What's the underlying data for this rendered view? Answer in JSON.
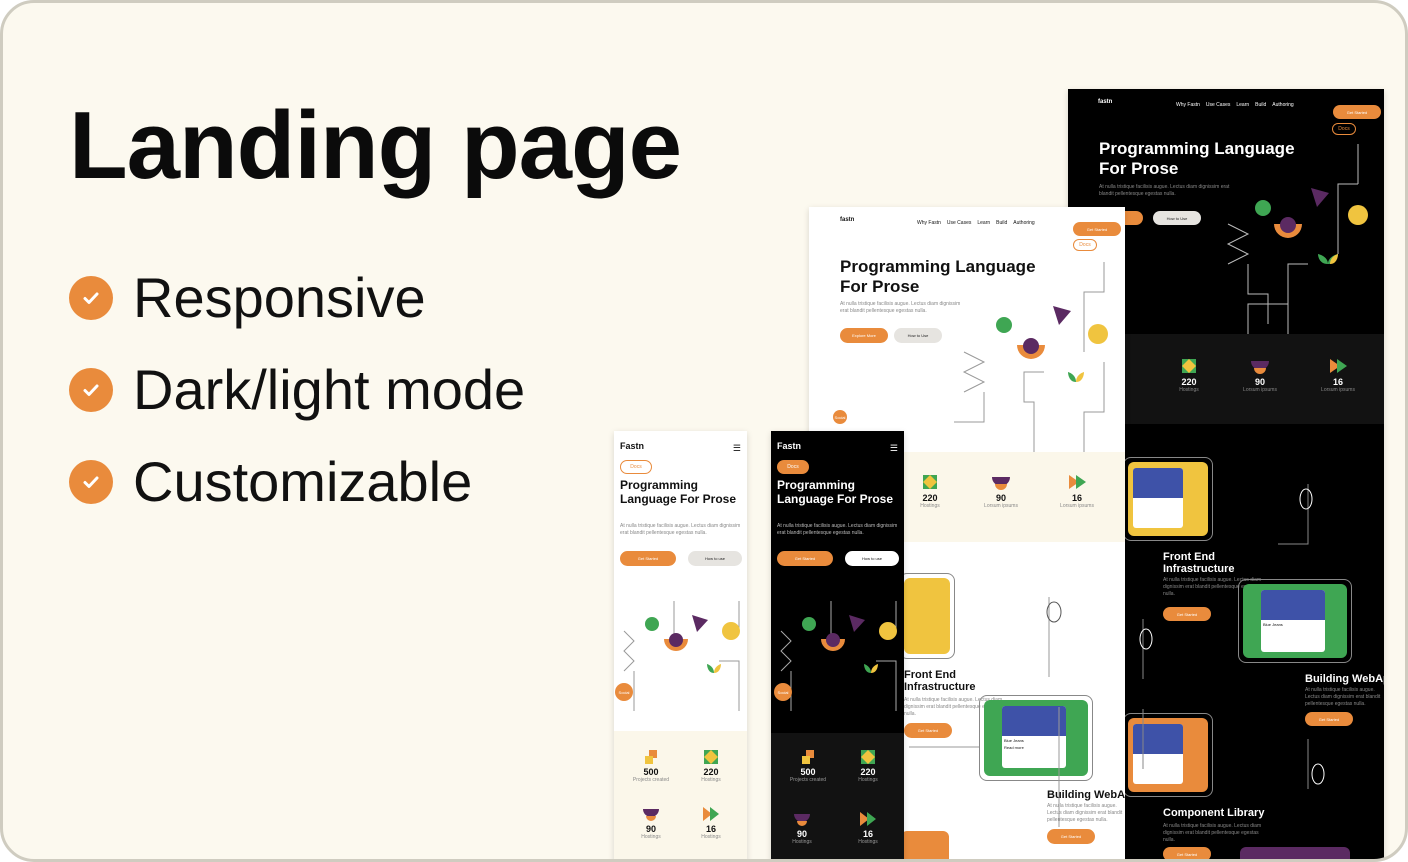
{
  "headline": "Landing page",
  "features": [
    {
      "label": "Responsive",
      "icon": "check-circle-icon"
    },
    {
      "label": "Dark/light mode",
      "icon": "check-circle-icon"
    },
    {
      "label": "Customizable",
      "icon": "check-circle-icon"
    }
  ],
  "colors": {
    "accent": "#e98b3c",
    "background": "#fcf9ef",
    "green": "#3fa653",
    "purple": "#5b2a62",
    "yellow": "#f0c43f"
  },
  "desktop": {
    "logo": "fastn",
    "nav": [
      "Why Fastn",
      "Use Cases",
      "Learn",
      "Build",
      "Authoring"
    ],
    "get_started": "Get Started",
    "docs": "Docs",
    "hero_title_1": "Programming Language",
    "hero_title_2": "For Prose",
    "hero_text": "At nulla tristique facilisis augue. Lectus diam dignissim erat blandit pellentesque egestas nulla.",
    "explore": "Explore More",
    "how_to_use": "How to Use",
    "social": "Social",
    "stats": [
      {
        "value": "220",
        "label": "Hostings"
      },
      {
        "value": "90",
        "label": "Lorsum ipsums"
      },
      {
        "value": "16",
        "label": "Lorsum ipsums"
      }
    ],
    "sections": [
      {
        "title_1": "Front End",
        "title_2": "Infrastructure",
        "text": "At nulla tristique facilisis augue. Lectus diam dignissim erat blandit pellentesque egestas nulla."
      },
      {
        "title_1": "Building WebApp",
        "text": "At nulla tristique facilisis augue. Lectus diam dignissim erat blandit pellentesque egestas nulla."
      },
      {
        "title_1": "Component Library",
        "text": "At nulla tristique facilisis augue. Lectus diam dignissim erat blandit pellentesque egestas nulla."
      }
    ],
    "card_name": "Blue Jeans",
    "card_more": "Read more"
  },
  "mobile": {
    "logo": "Fastn",
    "docs": "Docs",
    "hero_title_1": "Programming",
    "hero_title_2": "Language For Prose",
    "hero_text": "At nulla tristique facilisis augue. Lectus diam dignissim erat blandit pellentesque egestas nulla.",
    "get_started": "Get Started",
    "how_to_use": "How to use",
    "social": "Social",
    "stats": [
      {
        "value": "500",
        "label": "Projects created"
      },
      {
        "value": "220",
        "label": "Hostings"
      },
      {
        "value": "90",
        "label": "Hostings"
      },
      {
        "value": "16",
        "label": "Hostings"
      }
    ]
  }
}
